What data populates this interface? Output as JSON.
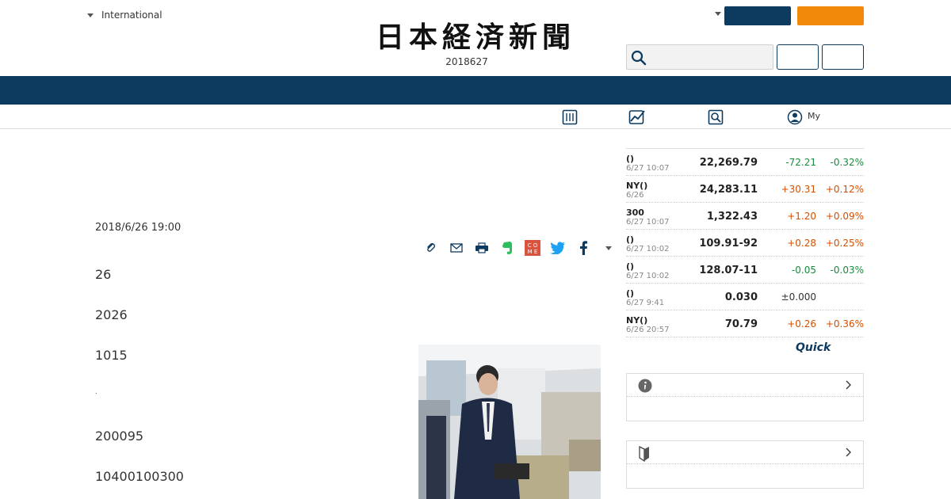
{
  "header": {
    "edition_label": "International",
    "logo_text": "日本経済新聞",
    "date": "2018627"
  },
  "subnav": {
    "my_label": "My"
  },
  "article": {
    "published": "2018/6/26 19:00",
    "paragraphs": [
      "26",
      "2026",
      "1015",
      ".",
      "200095",
      "10400100300"
    ]
  },
  "market": {
    "rows": [
      {
        "name": "()",
        "time": "6/27 10:07",
        "value": "22,269.79",
        "change": "-72.21",
        "pct": "-0.32%",
        "dir": "down"
      },
      {
        "name": "NY()",
        "time": "6/26",
        "value": "24,283.11",
        "change": "+30.31",
        "pct": "+0.12%",
        "dir": "up"
      },
      {
        "name": "300",
        "time": "6/27 10:07",
        "value": "1,322.43",
        "change": "+1.20",
        "pct": "+0.09%",
        "dir": "up"
      },
      {
        "name": "()",
        "time": "6/27 10:02",
        "value": "109.91-92",
        "change": "+0.28",
        "pct": "+0.25%",
        "dir": "up"
      },
      {
        "name": "()",
        "time": "6/27 10:02",
        "value": "128.07-11",
        "change": "-0.05",
        "pct": "-0.03%",
        "dir": "down"
      },
      {
        "name": "()",
        "time": "6/27 9:41",
        "value": "0.030",
        "change": "±0.000",
        "pct": "",
        "dir": "flat"
      },
      {
        "name": "NY()",
        "time": "6/26 20:57",
        "value": "70.79",
        "change": "+0.26",
        "pct": "+0.36%",
        "dir": "up"
      }
    ],
    "provider": "Quick"
  },
  "colors": {
    "navy": "#0d3a5f",
    "orange": "#f18a0b",
    "up": "#d24f00",
    "down": "#1a8a3e"
  },
  "icons": [
    "caret-down-icon",
    "search-icon",
    "newspaper-icon",
    "chart-icon",
    "magnifier-icon",
    "user-icon",
    "clip-icon",
    "mail-icon",
    "print-icon",
    "evernote-icon",
    "comment-icon",
    "twitter-icon",
    "facebook-icon",
    "info-icon",
    "beginner-icon",
    "chevron-right-icon"
  ]
}
